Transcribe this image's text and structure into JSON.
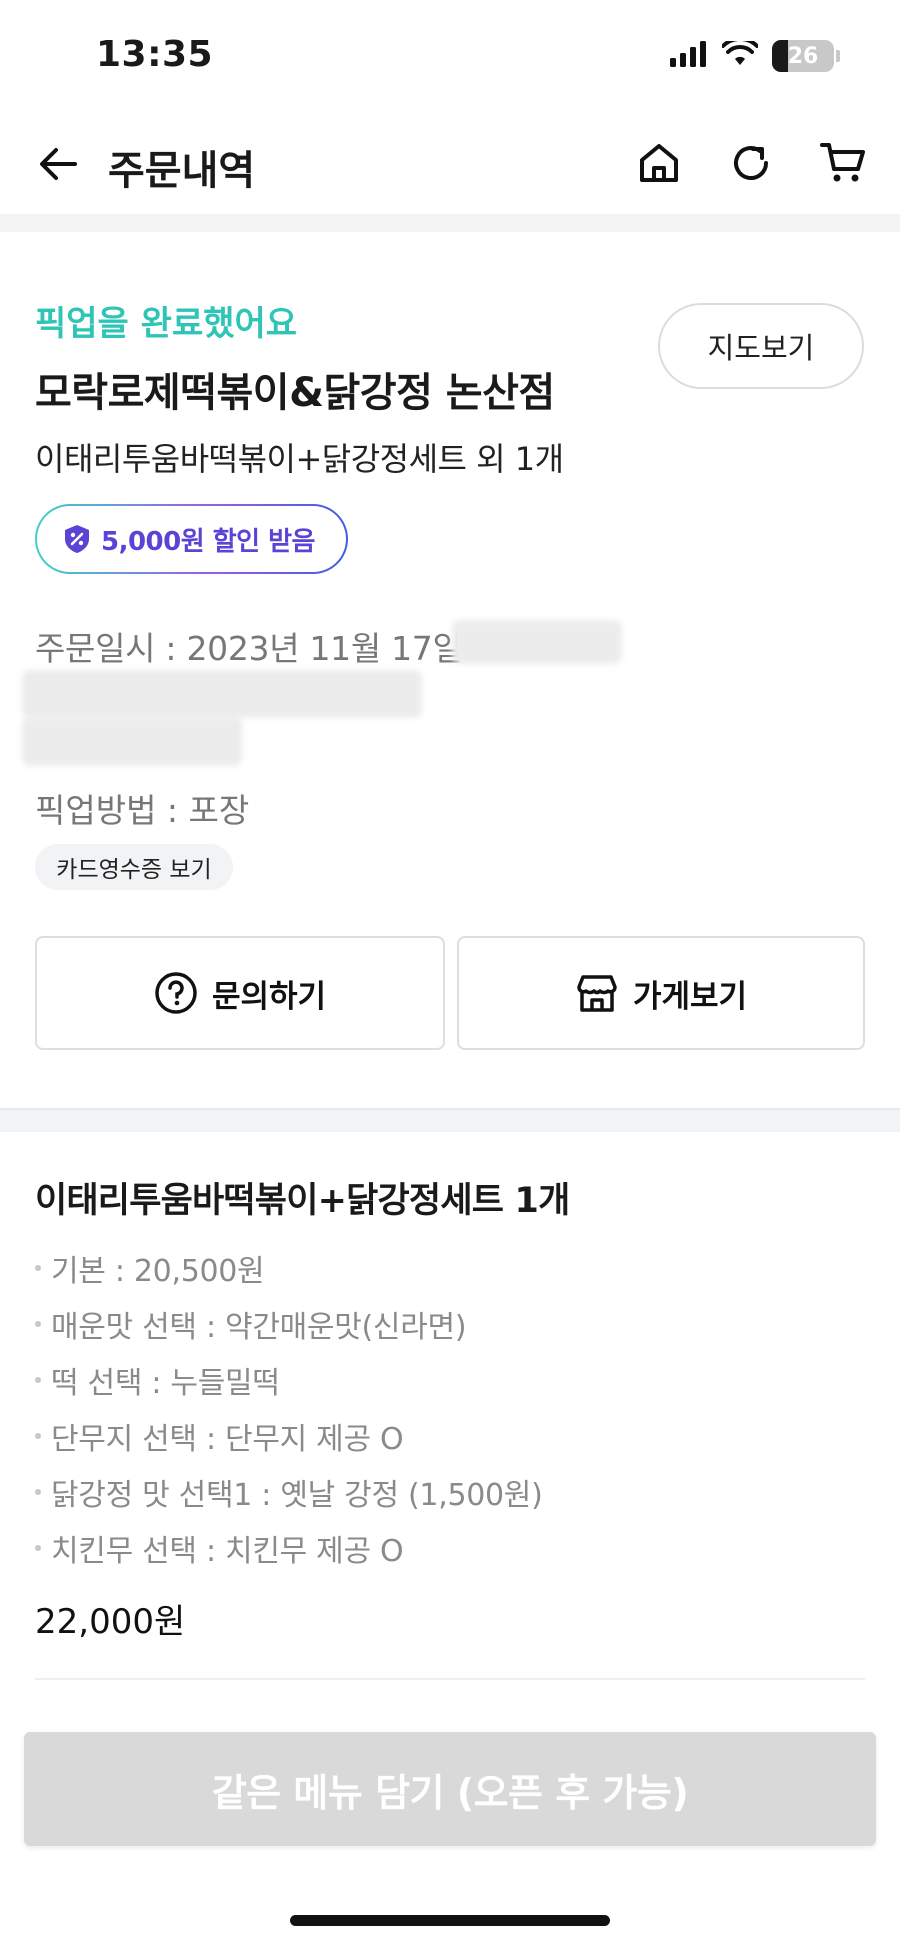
{
  "status_bar": {
    "time": "13:35",
    "battery": "26"
  },
  "header": {
    "title": "주문내역",
    "icons": [
      "back-arrow-icon",
      "home-icon",
      "refresh-icon",
      "cart-icon"
    ]
  },
  "order": {
    "status_message": "픽업을 완료했어요",
    "map_button": "지도보기",
    "store_name": "모락로제떡볶이&닭강정 논산점",
    "items_summary": "이태리투움바떡볶이+닭강정세트 외 1개",
    "discount_badge": "5,000원 할인 받음",
    "order_datetime": "주문일시 : 2023년 11월 17일",
    "pickup_method": "픽업방법 : 포장",
    "receipt_chip": "카드영수증 보기",
    "inquiry_button": "문의하기",
    "store_button": "가게보기"
  },
  "menu": {
    "title": "이태리투움바떡볶이+닭강정세트 1개",
    "options": [
      "기본 : 20,500원",
      "매운맛 선택 : 약간매운맛(신라면)",
      "떡 선택 : 누들밀떡",
      "단무지 선택 : 단무지 제공 O",
      "닭강정 맛 선택1 : 옛날 강정 (1,500원)",
      "치킨무 선택 : 치킨무 제공 O"
    ],
    "price": "22,000원"
  },
  "reorder_button": "같은 메뉴 담기 (오픈 후 가능)",
  "colors": {
    "accent_teal": "#2ec4b6",
    "discount_purple": "#5b43d6",
    "disabled_gray": "#d9d9d9"
  }
}
